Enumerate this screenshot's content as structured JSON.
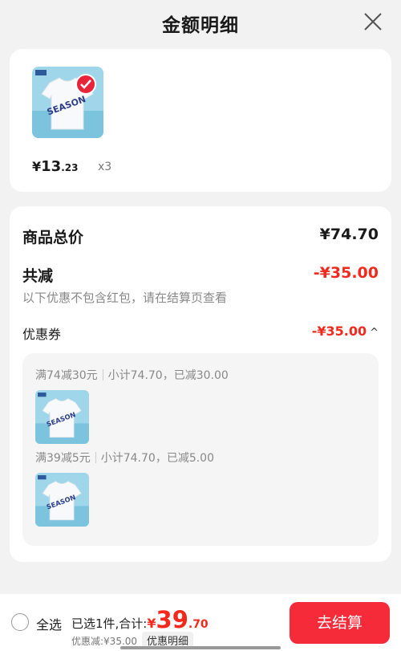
{
  "header": {
    "title": "金额明细",
    "close_icon": "close-icon"
  },
  "product_card": {
    "selected_icon": "checkmark-icon",
    "price_symbol": "¥",
    "price_int": "13",
    "price_dec": ".23",
    "quantity": "x3"
  },
  "breakdown": {
    "total_label": "商品总价",
    "total_value": "¥74.70",
    "reduce_label": "共减",
    "reduce_value": "-¥35.00",
    "reduce_note": "以下优惠不包含红包，请在结算页查看",
    "coupon_label": "优惠券",
    "coupon_value": "-¥35.00",
    "coupon_chevron": "^",
    "rules": [
      {
        "title": "满74减30元",
        "detail": "小计74.70，已减30.00"
      },
      {
        "title": "满39减5元",
        "detail": "小计74.70，已减5.00"
      }
    ]
  },
  "bottom_bar": {
    "select_all": "全选",
    "summary_prefix": "已选1件,合计:",
    "sum_symbol": "¥",
    "sum_int": "39",
    "sum_dec": ".70",
    "discount_text": "优惠减:¥35.00",
    "detail_chip": "优惠明细",
    "checkout": "去结算"
  },
  "colors": {
    "accent_red": "#f2291c",
    "button_red": "#f62b3a",
    "background": "#f2f2f2"
  }
}
